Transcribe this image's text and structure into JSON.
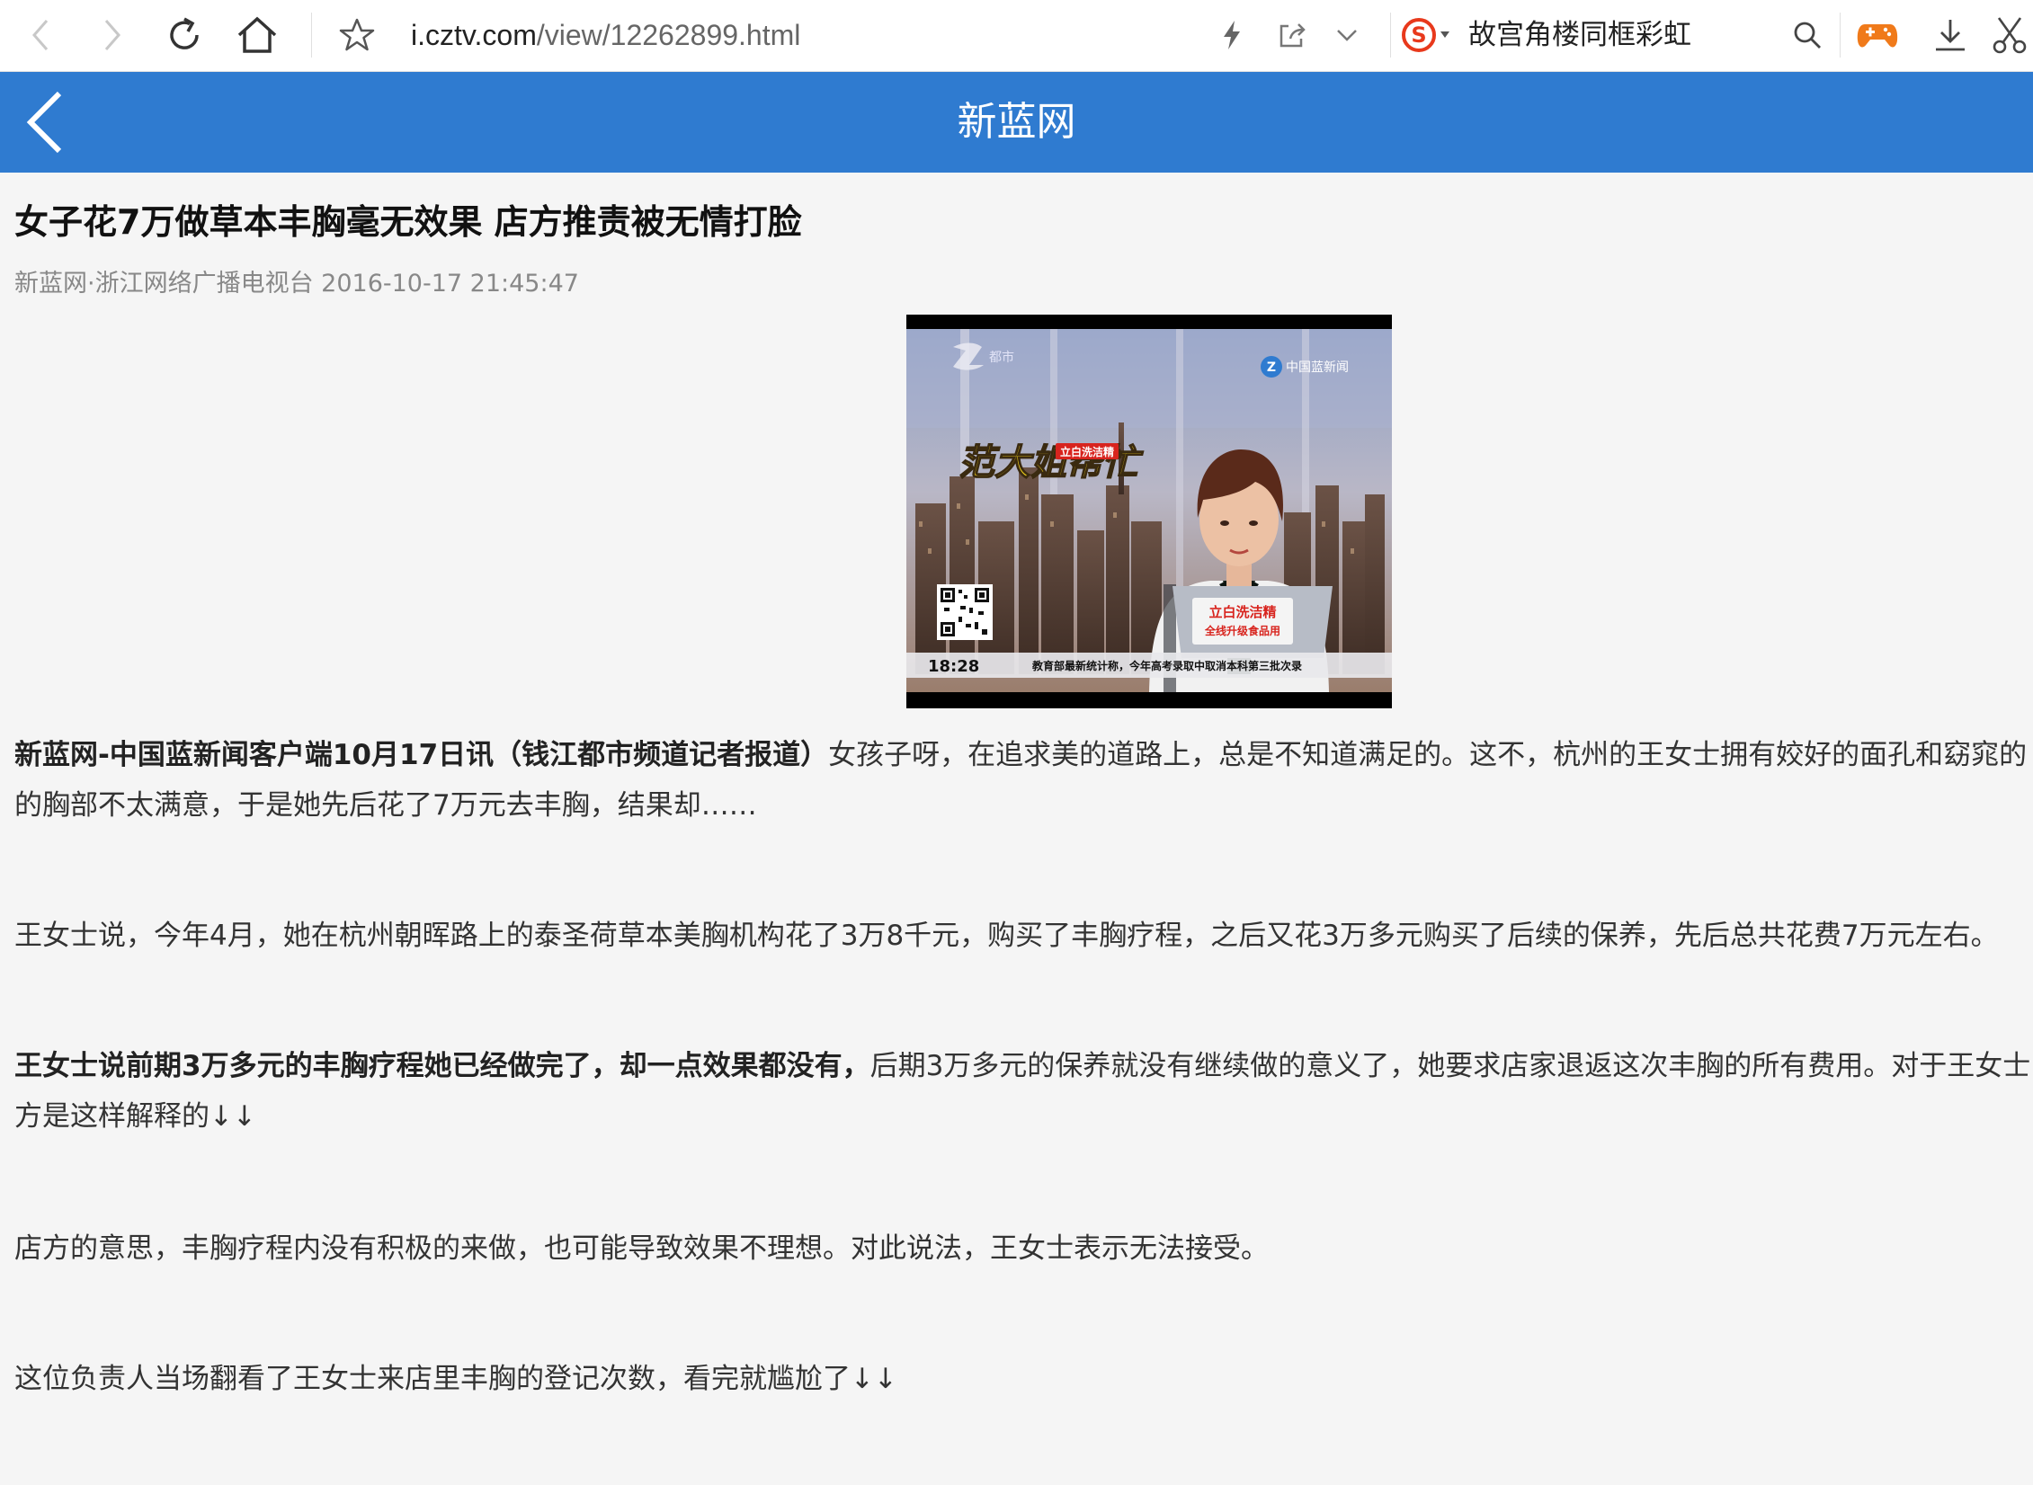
{
  "browser": {
    "url_host": "i.cztv.com",
    "url_path": "/view/12262899.html",
    "search_text": "故宫角楼同框彩虹"
  },
  "app": {
    "title": "新蓝网"
  },
  "article": {
    "headline": "女子花7万做草本丰胸毫无效果 店方推责被无情打脸",
    "meta": "新蓝网·浙江网络广播电视台 2016-10-17 21:45:47",
    "video": {
      "timestamp": "18:28",
      "ticker": "教育部最新统计称，今年高考录取中取消本科第三批次录",
      "channel_logo": "中国蓝新闻",
      "sponsor": "立白洗洁精",
      "sponsor_sub": "全线升级食品用",
      "show_logo": "范大姐帮忙"
    },
    "paragraphs": [
      {
        "bold": "新蓝网-中国蓝新闻客户端10月17日讯（钱江都市频道记者报道）",
        "line1": "女孩子呀，在追求美的道路上，总是不知道满足的。这不，杭州的王女士拥有姣好的面孔和窈窕的",
        "line2": "的胸部不太满意，于是她先后花了7万元去丰胸，结果却……"
      },
      {
        "line1": "王女士说，今年4月，她在杭州朝晖路上的泰圣荷草本美胸机构花了3万8千元，购买了丰胸疗程，之后又花3万多元购买了后续的保养，先后总共花费7万元左右。"
      },
      {
        "bold": "王女士说前期3万多元的丰胸疗程她已经做完了，却一点效果都没有，",
        "line1": "后期3万多元的保养就没有继续做的意义了，她要求店家退返这次丰胸的所有费用。对于王女士",
        "line2": "方是这样解释的↓↓"
      },
      {
        "line1": "店方的意思，丰胸疗程内没有积极的来做，也可能导致效果不理想。对此说法，王女士表示无法接受。"
      },
      {
        "line1": "这位负责人当场翻看了王女士来店里丰胸的登记次数，看完就尴尬了↓↓"
      }
    ]
  }
}
